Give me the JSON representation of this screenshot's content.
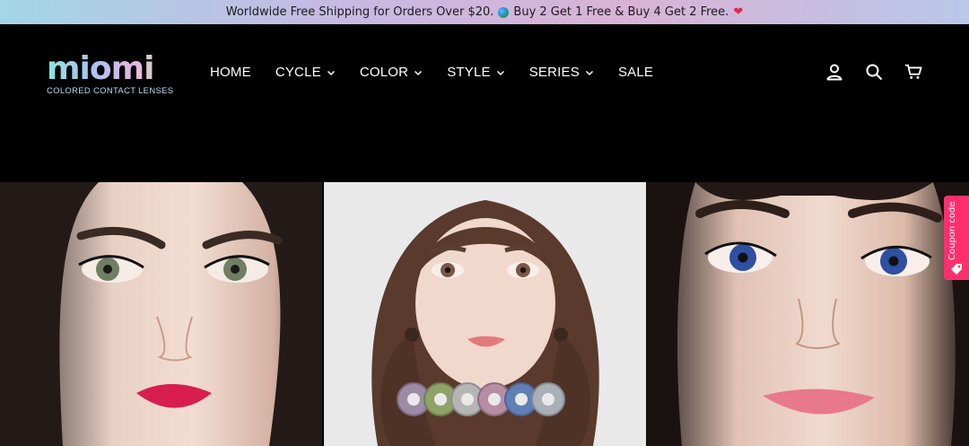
{
  "announcement": {
    "text_before": "Worldwide Free Shipping for Orders Over $20.",
    "globe_icon": "globe-icon",
    "text_after": "Buy 2 Get 1 Free & Buy 4 Get 2 Free.",
    "heart_icon": "heart-icon"
  },
  "logo": {
    "word": "miomi",
    "tagline": "COLORED CONTACT LENSES"
  },
  "nav": {
    "items": [
      {
        "label": "HOME",
        "dropdown": false
      },
      {
        "label": "CYCLE",
        "dropdown": true
      },
      {
        "label": "COLOR",
        "dropdown": true
      },
      {
        "label": "STYLE",
        "dropdown": true
      },
      {
        "label": "SERIES",
        "dropdown": true
      },
      {
        "label": "SALE",
        "dropdown": false
      }
    ]
  },
  "header_icons": [
    "account-icon",
    "search-icon",
    "cart-icon"
  ],
  "hero": {
    "panels": [
      {
        "name": "hero-image-left",
        "lens_color": "#6f7f63"
      },
      {
        "name": "hero-image-center",
        "lens_color": "#7a5746"
      },
      {
        "name": "hero-image-right",
        "lens_color": "#2f4fa3"
      }
    ]
  },
  "coupon": {
    "label": "Coupon code",
    "color": "#ff2f6e"
  },
  "colors": {
    "header_bg": "#000000",
    "nav_text": "#ffffff"
  }
}
